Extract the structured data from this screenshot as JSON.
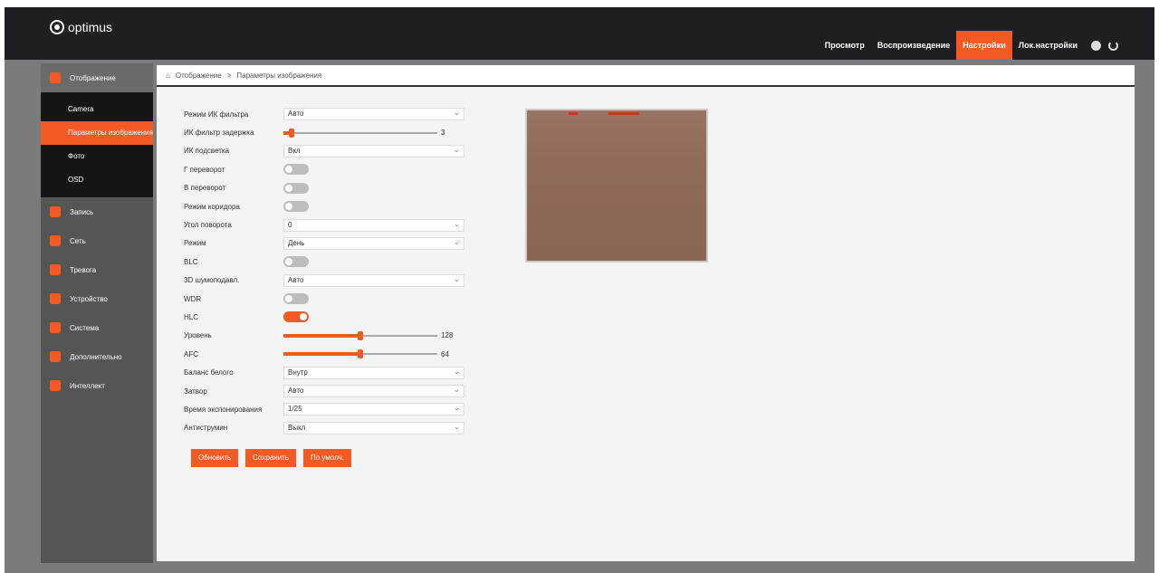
{
  "brand": {
    "name": "optimus"
  },
  "topnav": {
    "items": [
      "Просмотр",
      "Воспроизведение",
      "Настройки",
      "Лок.настройки"
    ],
    "active_index": 2
  },
  "sidebar": {
    "image_section": "Отображение",
    "image_sub": [
      "Camera",
      "Параметры изображения",
      "Фото",
      "OSD"
    ],
    "active_sub_index": 1,
    "sections": [
      "Запись",
      "Сеть",
      "Тревога",
      "Устройство",
      "Система",
      "Дополнительно",
      "Интеллект"
    ]
  },
  "breadcrumb": {
    "home_icon": "home-icon",
    "part1": "Отображение",
    "sep": ">",
    "part2": "Параметры изображения"
  },
  "form": {
    "rows": [
      {
        "label": "Режим ИК фильтра",
        "type": "select",
        "value": "Авто"
      },
      {
        "label": "ИК фильтр задержка",
        "type": "slider",
        "value": "3",
        "fraction": 0.05
      },
      {
        "label": "ИК подсветка",
        "type": "select",
        "value": "Вкл"
      },
      {
        "label": "Г переворот",
        "type": "toggle",
        "on": false
      },
      {
        "label": "В переворот",
        "type": "toggle",
        "on": false
      },
      {
        "label": "Режим коридора",
        "type": "toggle",
        "on": false
      },
      {
        "label": "Угол поворота",
        "type": "select",
        "value": "0"
      },
      {
        "label": "Режим",
        "type": "select",
        "value": "День"
      },
      {
        "label": "BLC",
        "type": "toggle",
        "on": false
      },
      {
        "label": "3D шумоподавл.",
        "type": "select",
        "value": "Авто"
      },
      {
        "label": "WDR",
        "type": "toggle",
        "on": false
      },
      {
        "label": "HLC",
        "type": "toggle",
        "on": true
      },
      {
        "label": "Уровень",
        "type": "slider",
        "value": "128",
        "fraction": 0.5
      },
      {
        "label": "AFC",
        "type": "slider",
        "value": "64",
        "fraction": 0.5
      },
      {
        "label": "Баланс белого",
        "type": "select",
        "value": "Внутр"
      },
      {
        "label": "Затвор",
        "type": "select",
        "value": "Авто"
      },
      {
        "label": "Время экспонирования",
        "type": "select",
        "value": "1/25"
      },
      {
        "label": "Антиструмин",
        "type": "select",
        "value": "Выкл"
      }
    ]
  },
  "buttons": {
    "refresh": "Обновить",
    "save": "Сохранить",
    "default": "По умолч."
  },
  "colors": {
    "accent": "#f15a22",
    "topbar": "#1f1f23",
    "sidebar": "#555555"
  }
}
